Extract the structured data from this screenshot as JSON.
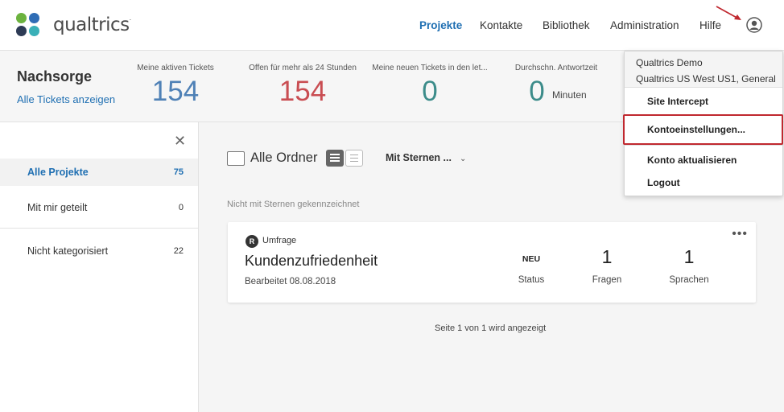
{
  "colors": {
    "accent": "#1f6fb2",
    "stat_blue": "#4f81b6",
    "stat_red": "#c94d52",
    "stat_teal": "#3c8c8a",
    "highlight": "#c0282f",
    "logo_green": "#6cb33f",
    "logo_blue": "#2f6db5",
    "logo_navy": "#2d3b55",
    "logo_teal": "#3ab0b8"
  },
  "header": {
    "logo_text": "qualtrics",
    "logo_mark": ".",
    "nav": [
      "Projekte",
      "Kontakte",
      "Bibliothek",
      "Administration",
      "Hilfe"
    ],
    "icons": {
      "user": "user-circle-icon",
      "arrow": "annotation-arrow-icon"
    }
  },
  "stats": {
    "title": "Nachsorge",
    "link": "Alle Tickets anzeigen",
    "items": [
      {
        "label": "Meine aktiven Tickets",
        "value": "154"
      },
      {
        "label": "Offen für mehr als 24 Stunden",
        "value": "154"
      },
      {
        "label": "Meine neuen Tickets in den let...",
        "value": "0"
      },
      {
        "label": "Durchschn. Antwortzeit",
        "value": "0",
        "unit": "Minuten"
      }
    ]
  },
  "sidebar": {
    "close": "✕",
    "items": [
      {
        "label": "Alle Projekte",
        "count": "75"
      },
      {
        "label": "Mit mir geteilt",
        "count": "0"
      },
      {
        "label": "Nicht kategorisiert",
        "count": "22"
      }
    ]
  },
  "main": {
    "folder_label": "Alle Ordner",
    "sort_label": "Mit Sternen ...",
    "sort_chevron": "⌄",
    "section_label": "Nicht mit Sternen gekennzeichnet",
    "project": {
      "badge": "R",
      "type": "Umfrage",
      "title": "Kundenzufriedenheit",
      "edited": "Bearbeitet 08.08.2018",
      "status_value": "NEU",
      "status_label": "Status",
      "questions_value": "1",
      "questions_label": "Fragen",
      "languages_value": "1",
      "languages_label": "Sprachen",
      "menu": "•••"
    },
    "pager": "Seite 1 von 1 wird angezeigt"
  },
  "dropdown": {
    "account_name": "Qualtrics Demo",
    "account_org": "Qualtrics US West US1, General",
    "items": [
      "Site Intercept",
      "Kontoeinstellungen...",
      "Konto aktualisieren",
      "Logout"
    ]
  }
}
